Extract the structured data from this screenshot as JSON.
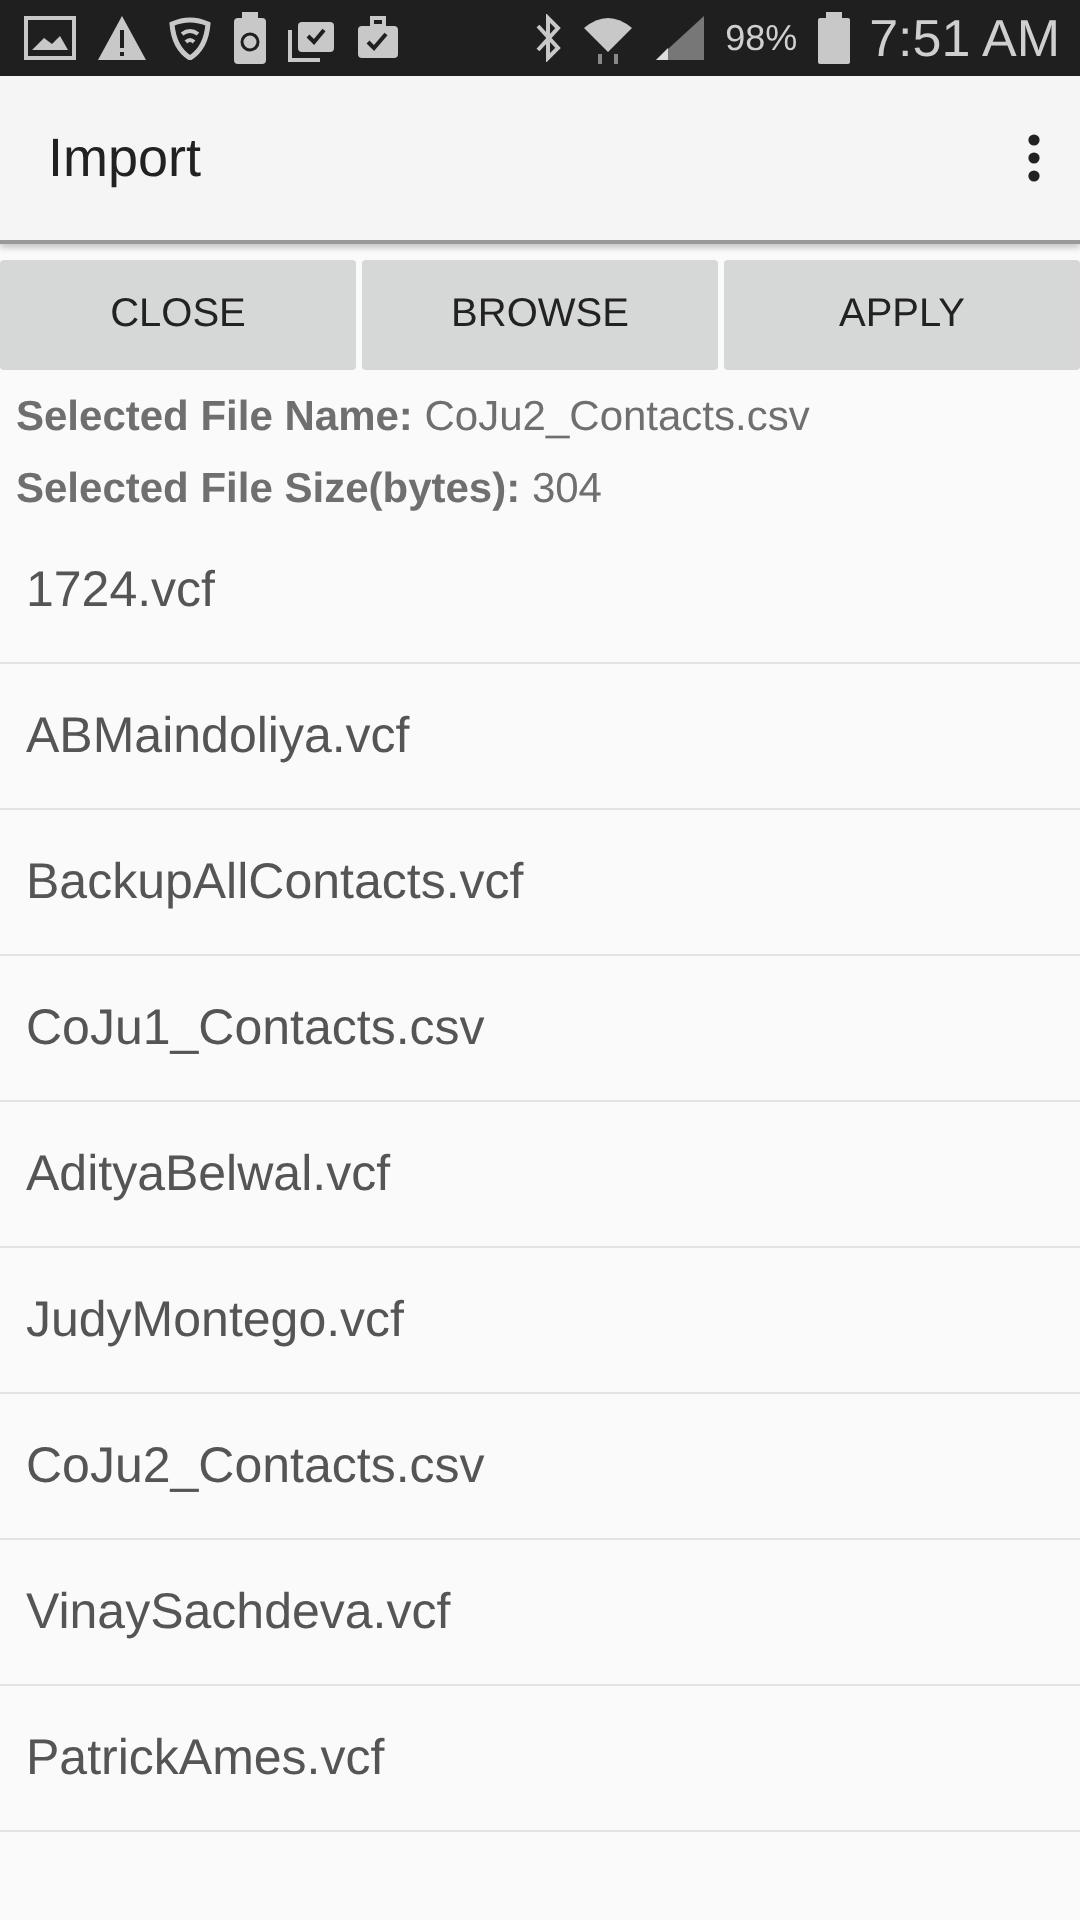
{
  "status_bar": {
    "battery": "98%",
    "time": "7:51 AM"
  },
  "app_bar": {
    "title": "Import"
  },
  "buttons": [
    "CLOSE",
    "BROWSE",
    "APPLY"
  ],
  "info": [
    {
      "label": "Selected File Name:",
      "value": "CoJu2_Contacts.csv"
    },
    {
      "label": "Selected File Size(bytes):",
      "value": "304"
    }
  ],
  "files": [
    "1724.vcf",
    "ABMaindoliya.vcf",
    "BackupAllContacts.vcf",
    "CoJu1_Contacts.csv",
    "AdityaBelwal.vcf",
    "JudyMontego.vcf",
    "CoJu2_Contacts.csv",
    "VinaySachdeva.vcf",
    "PatrickAmes.vcf"
  ]
}
